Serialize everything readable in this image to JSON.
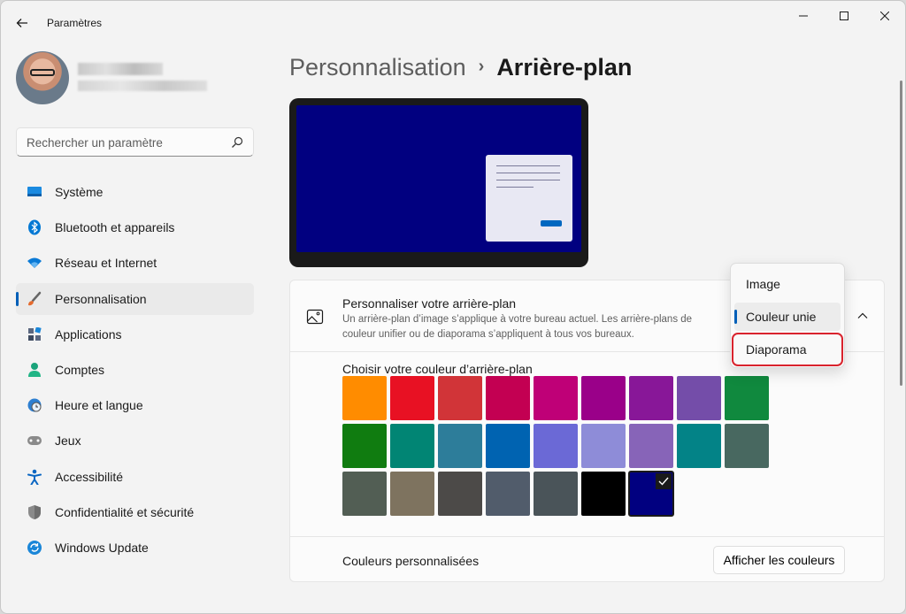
{
  "window": {
    "title": "Paramètres"
  },
  "sidebar": {
    "search_placeholder": "Rechercher un paramètre",
    "items": [
      {
        "label": "Système",
        "icon": "monitor-icon",
        "color": "#0078d4"
      },
      {
        "label": "Bluetooth et appareils",
        "icon": "bluetooth-icon",
        "color": "#0078d4"
      },
      {
        "label": "Réseau et Internet",
        "icon": "wifi-icon",
        "color": "#0078d4"
      },
      {
        "label": "Personnalisation",
        "icon": "brush-icon",
        "color": "#e46b2f",
        "active": true
      },
      {
        "label": "Applications",
        "icon": "apps-icon",
        "color": "#4a5870"
      },
      {
        "label": "Comptes",
        "icon": "account-icon",
        "color": "#1aa37a"
      },
      {
        "label": "Heure et langue",
        "icon": "globe-clock-icon",
        "color": "#2d7fd1"
      },
      {
        "label": "Jeux",
        "icon": "gamepad-icon",
        "color": "#6b6b6b"
      },
      {
        "label": "Accessibilité",
        "icon": "accessibility-icon",
        "color": "#0a66c2"
      },
      {
        "label": "Confidentialité et sécurité",
        "icon": "shield-icon",
        "color": "#8a8a8a"
      },
      {
        "label": "Windows Update",
        "icon": "update-icon",
        "color": "#1a86d8"
      }
    ]
  },
  "header": {
    "parent": "Personnalisation",
    "separator": "›",
    "current": "Arrière-plan"
  },
  "background_card": {
    "title": "Personnaliser votre arrière-plan",
    "description": "Un arrière-plan d’image s’applique à votre bureau actuel. Les arrière-plans de couleur unifier ou de diaporama s’appliquent à tous vos bureaux.",
    "color_section_title": "Choisir votre couleur d’arrière-plan",
    "colors": [
      "#ff8c00",
      "#e81123",
      "#d13438",
      "#c30052",
      "#bf0077",
      "#9a0089",
      "#881798",
      "#744da9",
      "#10893e",
      "#107c10",
      "#018574",
      "#2d7d9a",
      "#0063b1",
      "#6b69d6",
      "#8e8cd8",
      "#8764b8",
      "#038387",
      "#486860",
      "#525e54",
      "#7e735f",
      "#4c4a48",
      "#515c6b",
      "#4a5459",
      "#000000",
      "#010080"
    ],
    "selected_color_index": 24,
    "custom_colors_label": "Couleurs personnalisées",
    "show_colors_button": "Afficher les couleurs"
  },
  "dropdown": {
    "options": [
      "Image",
      "Couleur unie",
      "Diaporama"
    ],
    "selected": "Couleur unie",
    "highlighted": "Diaporama"
  }
}
